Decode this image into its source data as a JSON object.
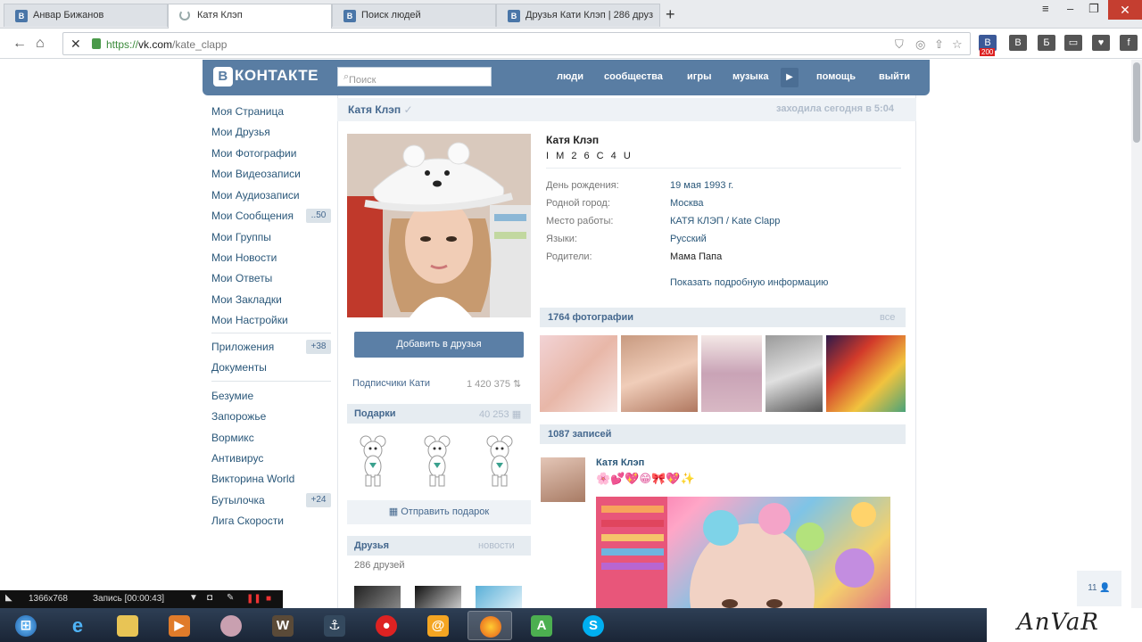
{
  "browser": {
    "tabs": [
      {
        "label": "Анвар Бижанов"
      },
      {
        "label": "Катя Клэп"
      },
      {
        "label": "Поиск людей"
      },
      {
        "label": "Друзья Кати Клэп | 286 друз"
      }
    ],
    "new_tab": "+",
    "url": {
      "scheme": "https://",
      "host": "vk.com",
      "path": "/kate_clapp"
    },
    "extensions": [
      "В",
      "Б",
      "▭",
      "♥",
      "f"
    ],
    "ext_badge": "200"
  },
  "vk": {
    "logo": "КОНТАКТЕ",
    "logo_letter": "В",
    "search_placeholder": "Поиск",
    "nav": [
      "люди",
      "сообщества",
      "игры",
      "музыка",
      "помощь",
      "выйти"
    ],
    "menu": [
      {
        "label": "Моя Страница"
      },
      {
        "label": "Мои Друзья"
      },
      {
        "label": "Мои Фотографии"
      },
      {
        "label": "Мои Видеозаписи"
      },
      {
        "label": "Мои Аудиозаписи"
      },
      {
        "label": "Мои Сообщения",
        "badge": "..50"
      },
      {
        "label": "Мои Группы"
      },
      {
        "label": "Мои Новости"
      },
      {
        "label": "Мои Ответы"
      },
      {
        "label": "Мои Закладки"
      },
      {
        "label": "Мои Настройки"
      }
    ],
    "menu2": [
      {
        "label": "Приложения",
        "badge": "+38"
      },
      {
        "label": "Документы"
      }
    ],
    "apps": [
      {
        "label": "Безумие"
      },
      {
        "label": "Запорожье"
      },
      {
        "label": "Вормикс"
      },
      {
        "label": "Антивирус"
      },
      {
        "label": "Викторина World"
      },
      {
        "label": "Бутылочка",
        "badge": "+24"
      },
      {
        "label": "Лига Скорости"
      }
    ]
  },
  "profile": {
    "header_name": "Катя Клэп",
    "last_seen": "заходила сегодня в 5:04",
    "add_friend": "Добавить в друзья",
    "subscribers_label": "Подписчики Кати",
    "subscribers_count": "1 420 375",
    "gifts_title": "Подарки",
    "gifts_count": "40 253",
    "send_gift": "Отправить подарок",
    "friends_title": "Друзья",
    "friends_news": "новости",
    "friends_count": "286 друзей",
    "name": "Катя Клэп",
    "status": "I M 2 6 C 4 U",
    "info": [
      {
        "label": "День рождения:",
        "value": "19 мая 1993 г."
      },
      {
        "label": "Родной город:",
        "value": "Москва"
      },
      {
        "label": "Место работы:",
        "value": "КАТЯ КЛЭП / Kate Clapp"
      },
      {
        "label": "Языки:",
        "value": "Русский"
      },
      {
        "label": "Родители:",
        "value": "Мама Папа"
      }
    ],
    "show_more": "Показать подробную информацию",
    "photos_title": "1764 фотографии",
    "photos_all": "все",
    "posts_title": "1087 записей",
    "post": {
      "author": "Катя Клэп",
      "text": "🌸💕💖😁🎀💖✨"
    },
    "likes": "11"
  },
  "recorder": {
    "resolution": "1366x768",
    "status": "Запись [00:00:43]"
  },
  "watermark": "AnVaR",
  "colors": {
    "vk_blue": "#597da3",
    "link": "#2b587a",
    "close": "#c53e30"
  }
}
